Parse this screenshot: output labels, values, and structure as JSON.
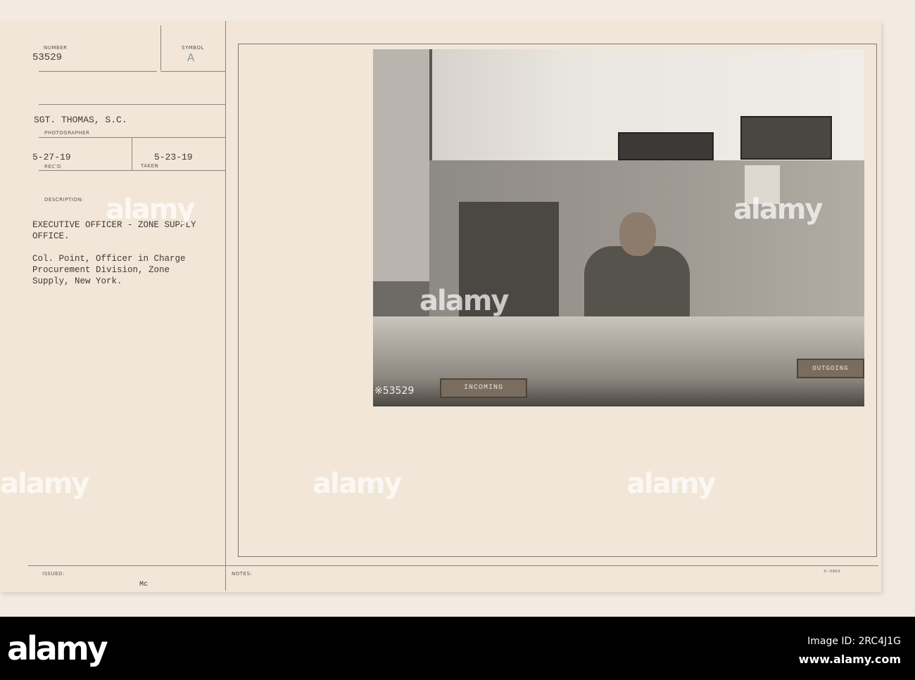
{
  "card": {
    "number_label": "NUMBER",
    "number": "53529",
    "symbol_label": "SYMBOL",
    "symbol": "A",
    "photographer": "SGT. THOMAS, S.C.",
    "photographer_label": "PHOTOGRAPHER",
    "received": "5-27-19",
    "received_label": "REC'D",
    "taken": "5-23-19",
    "taken_label": "TAKEN",
    "description_label": "DESCRIPTION:",
    "description_lines": [
      "EXECUTIVE OFFICER - ZONE SUPPLY",
      "OFFICE.",
      "",
      "Col. Point, Officer in Charge",
      "Procurement Division, Zone",
      "Supply, New York."
    ],
    "issued_label": "ISSUED:",
    "issued_initials": "Mc",
    "notes_label": "NOTES:",
    "form_number": "3—5603"
  },
  "photo": {
    "negative_number": "53529",
    "incoming_label": "INCOMING",
    "outgoing_label": "OUTGOING"
  },
  "watermark": "alamy",
  "footer": {
    "logo": "alamy",
    "image_id": "Image ID: 2RC4J1G",
    "url": "www.alamy.com"
  }
}
